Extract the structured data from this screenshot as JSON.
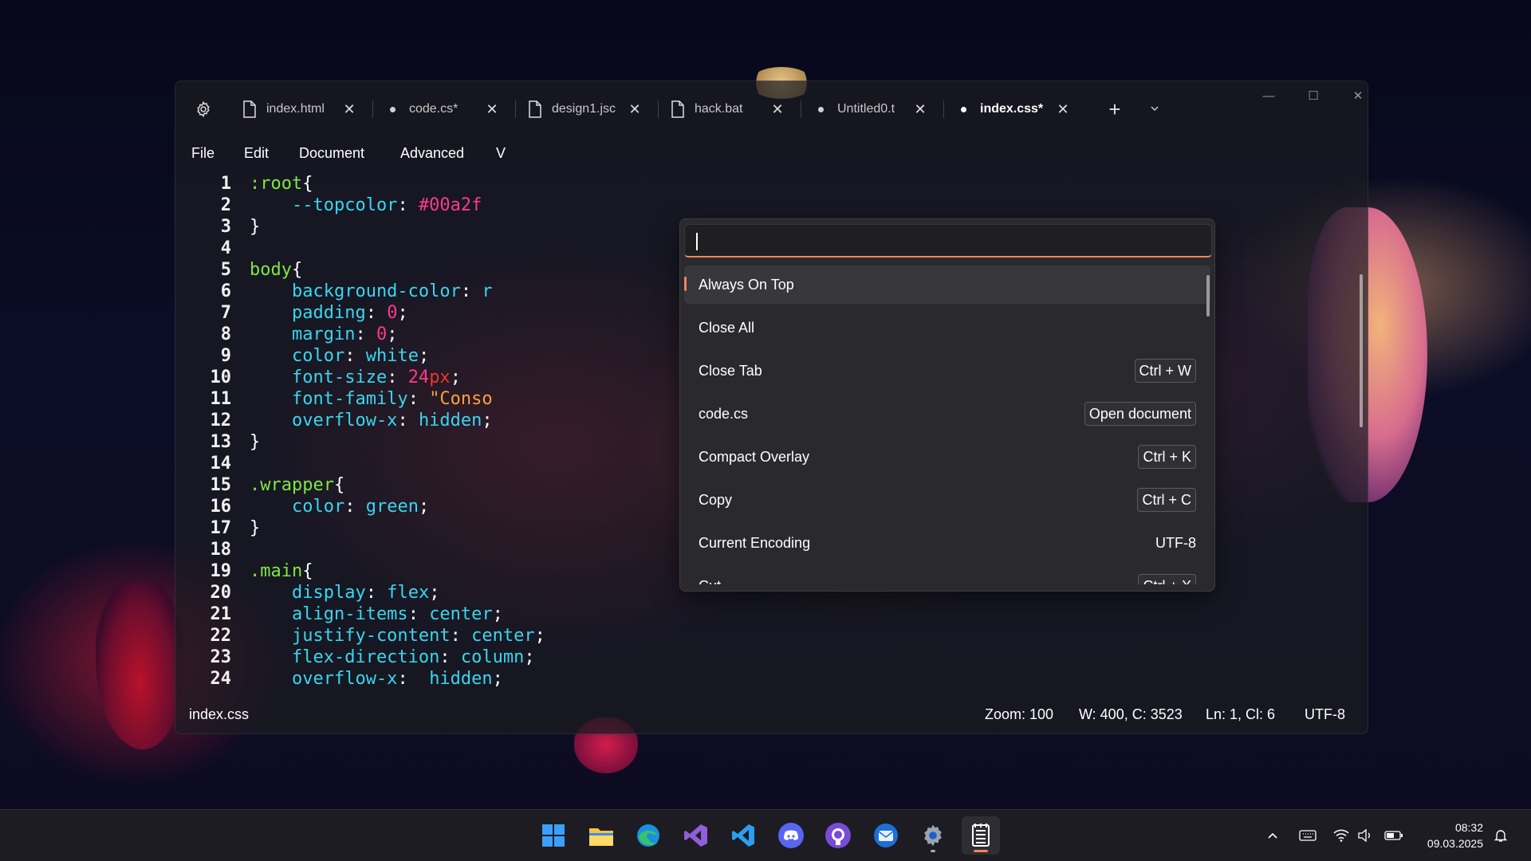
{
  "window": {
    "tabs": [
      {
        "label": "index.html",
        "icon": "file-icon",
        "modified": false,
        "active": false
      },
      {
        "label": "code.cs*",
        "icon": "dot",
        "modified": true,
        "active": false
      },
      {
        "label": "design1.jsc",
        "icon": "file-icon",
        "modified": false,
        "active": false
      },
      {
        "label": "hack.bat",
        "icon": "file-icon",
        "modified": false,
        "active": false
      },
      {
        "label": "Untitled0.t",
        "icon": "dot",
        "modified": true,
        "active": false
      },
      {
        "label": "index.css*",
        "icon": "dot",
        "modified": true,
        "active": true
      }
    ],
    "close_glyph": "✕",
    "new_tab_glyph": "+",
    "tab_list_glyph": "⌄",
    "controls": {
      "minimize": "—",
      "maximize": "☐",
      "close": "✕"
    }
  },
  "menu": [
    "File",
    "Edit",
    "Document",
    "Advanced",
    "V"
  ],
  "editor": {
    "line_numbers": [
      "1",
      "2",
      "3",
      "4",
      "5",
      "6",
      "7",
      "8",
      "9",
      "10",
      "11",
      "12",
      "13",
      "14",
      "15",
      "16",
      "17",
      "18",
      "19",
      "20",
      "21",
      "22",
      "23",
      "24"
    ],
    "lines": [
      [
        [
          ":root",
          "sel"
        ],
        [
          "{",
          "pun"
        ]
      ],
      [
        [
          "    --topcolor",
          "prop"
        ],
        [
          ": ",
          "pun"
        ],
        [
          "#00a2f",
          "hex"
        ]
      ],
      [
        [
          "}",
          "pun"
        ]
      ],
      [],
      [
        [
          "body",
          "sel"
        ],
        [
          "{",
          "pun"
        ]
      ],
      [
        [
          "    background-color",
          "prop"
        ],
        [
          ": ",
          "pun"
        ],
        [
          "r",
          "val"
        ]
      ],
      [
        [
          "    padding",
          "prop"
        ],
        [
          ": ",
          "pun"
        ],
        [
          "0",
          "num"
        ],
        [
          ";",
          "pun"
        ]
      ],
      [
        [
          "    margin",
          "prop"
        ],
        [
          ": ",
          "pun"
        ],
        [
          "0",
          "num"
        ],
        [
          ";",
          "pun"
        ]
      ],
      [
        [
          "    color",
          "prop"
        ],
        [
          ": ",
          "pun"
        ],
        [
          "white",
          "val"
        ],
        [
          ";",
          "pun"
        ]
      ],
      [
        [
          "    font-size",
          "prop"
        ],
        [
          ": ",
          "pun"
        ],
        [
          "24",
          "num"
        ],
        [
          "px",
          "unit"
        ],
        [
          ";",
          "pun"
        ]
      ],
      [
        [
          "    font-family",
          "prop"
        ],
        [
          ": ",
          "pun"
        ],
        [
          "\"Conso",
          "str"
        ]
      ],
      [
        [
          "    overflow-x",
          "prop"
        ],
        [
          ": ",
          "pun"
        ],
        [
          "hidden",
          "val"
        ],
        [
          ";",
          "pun"
        ]
      ],
      [
        [
          "}",
          "pun"
        ]
      ],
      [],
      [
        [
          ".wrapper",
          "sel"
        ],
        [
          "{",
          "pun"
        ]
      ],
      [
        [
          "    color",
          "prop"
        ],
        [
          ": ",
          "pun"
        ],
        [
          "green",
          "val"
        ],
        [
          ";",
          "pun"
        ]
      ],
      [
        [
          "}",
          "pun"
        ]
      ],
      [],
      [
        [
          ".main",
          "sel"
        ],
        [
          "{",
          "pun"
        ]
      ],
      [
        [
          "    display",
          "prop"
        ],
        [
          ": ",
          "pun"
        ],
        [
          "flex",
          "val"
        ],
        [
          ";",
          "pun"
        ]
      ],
      [
        [
          "    align-items",
          "prop"
        ],
        [
          ": ",
          "pun"
        ],
        [
          "center",
          "val"
        ],
        [
          ";",
          "pun"
        ]
      ],
      [
        [
          "    justify-content",
          "prop"
        ],
        [
          ": ",
          "pun"
        ],
        [
          "center",
          "val"
        ],
        [
          ";",
          "pun"
        ]
      ],
      [
        [
          "    flex-direction",
          "prop"
        ],
        [
          ": ",
          "pun"
        ],
        [
          "column",
          "val"
        ],
        [
          ";",
          "pun"
        ]
      ],
      [
        [
          "    overflow-x",
          "prop"
        ],
        [
          ":  ",
          "pun"
        ],
        [
          "hidden",
          "val"
        ],
        [
          ";",
          "pun"
        ]
      ]
    ]
  },
  "palette": {
    "input_value": "",
    "items": [
      {
        "label": "Always On Top",
        "key": "",
        "selected": true
      },
      {
        "label": "Close All",
        "key": ""
      },
      {
        "label": "Close Tab",
        "key": "Ctrl + W"
      },
      {
        "label": "code.cs",
        "key": "Open document"
      },
      {
        "label": "Compact Overlay",
        "key": "Ctrl + K"
      },
      {
        "label": "Copy",
        "key": "Ctrl + C"
      },
      {
        "label": "Current Encoding",
        "plain": "UTF-8"
      },
      {
        "label": "Cut",
        "key": "Ctrl + X"
      }
    ]
  },
  "status": {
    "filename": "index.css",
    "zoom": "Zoom: 100",
    "words": "W: 400, C: 3523",
    "position": "Ln: 1, Cl: 6",
    "encoding": "UTF-8"
  },
  "taskbar": {
    "apps": [
      {
        "name": "start",
        "active": false
      },
      {
        "name": "file-explorer",
        "active": false
      },
      {
        "name": "edge",
        "active": false
      },
      {
        "name": "visual-studio",
        "active": false
      },
      {
        "name": "vscode",
        "active": false
      },
      {
        "name": "discord",
        "active": false
      },
      {
        "name": "github-desktop",
        "active": false
      },
      {
        "name": "thunderbird",
        "active": false
      },
      {
        "name": "settings",
        "active": false,
        "running": true
      },
      {
        "name": "textpad",
        "active": true,
        "running": true
      }
    ],
    "time": "08:32",
    "date": "09.03.2025",
    "tray": {
      "chevron": "^"
    }
  },
  "colors": {
    "accent": "#f0845a",
    "selector": "#7ee840",
    "property": "#38d6ee",
    "number": "#ff3a8c",
    "string": "#ffa040"
  }
}
